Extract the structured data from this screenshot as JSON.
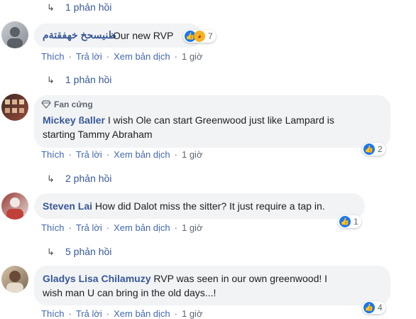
{
  "top_replies": {
    "label": "1 phản hồi"
  },
  "comments": [
    {
      "author": "ظنيسحخ خهفقتةم",
      "text": "Our new RVP",
      "reaction_count": "7",
      "actions": {
        "like": "Thích",
        "reply": "Trả lời",
        "translate": "Xem bản dịch",
        "time": "1 giờ"
      },
      "replies": "1 phản hồi"
    },
    {
      "badge": "Fan cứng",
      "author": "Mickey ßaller",
      "text_line1": "I wish Ole can start Greenwood just like Lampard is",
      "text_line2": "starting Tammy Abraham",
      "reaction_count": "2",
      "actions": {
        "like": "Thích",
        "reply": "Trả lời",
        "translate": "Xem bản dịch",
        "time": "1 giờ"
      },
      "replies": "2 phản hồi"
    },
    {
      "author": "Steven Lai",
      "text": "How did Dalot miss the sitter? It just require a tap in.",
      "reaction_count": "1",
      "actions": {
        "like": "Thích",
        "reply": "Trả lời",
        "translate": "Xem bản dịch",
        "time": "1 giờ"
      },
      "replies": "5 phản hồi"
    },
    {
      "author": "Gladys Lisa Chilamuzy",
      "text_line1": "RVP was seen in our own greenwood! I",
      "text_line2": "wish man U can bring in the old days...!",
      "reaction_count": "4",
      "actions": {
        "like": "Thích",
        "reply": "Trả lời",
        "translate": "Xem bản dịch",
        "time": "1 giờ"
      }
    }
  ],
  "colors": {
    "link": "#385898",
    "bubble": "#f2f3f5",
    "like": "#1877f2"
  }
}
